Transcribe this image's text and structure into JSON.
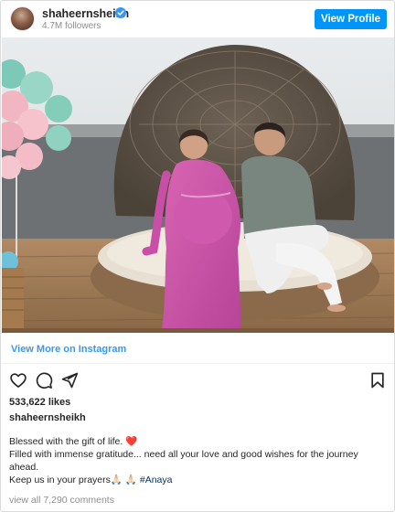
{
  "header": {
    "username": "shaheernsheikh",
    "followers": "4.7M followers",
    "view_profile": "View Profile"
  },
  "post": {
    "view_more": "View More on Instagram",
    "likes": "533,622 likes",
    "caption_user": "shaheernsheikh",
    "caption_lines": {
      "l1": "Blessed with the gift of life. ❤️",
      "l2": "Filled with immense gratitude... need all your love and good wishes for the journey ahead.",
      "l3_text": "Keep us in your prayers🙏🏻 🙏🏻 ",
      "l3_tag": "#Anaya"
    },
    "comments": "view all 7,290 comments"
  },
  "icons": [
    "heart-icon",
    "comment-icon",
    "share-icon",
    "bookmark-icon",
    "verified-badge-icon"
  ],
  "colors": {
    "accent": "#0095f6",
    "link": "#3897f0",
    "hashtag": "#00376b",
    "muted": "#8e8e8e",
    "dress": "#c94fa6"
  }
}
